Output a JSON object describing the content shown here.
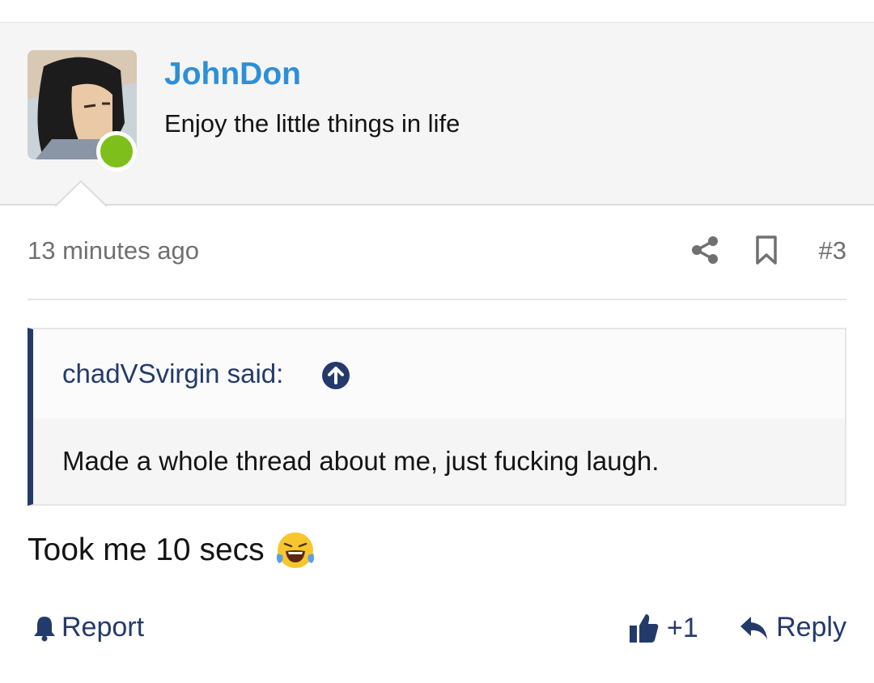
{
  "user": {
    "name": "JohnDon",
    "title": "Enjoy the little things in life",
    "online": true
  },
  "post": {
    "timestamp": "13 minutes ago",
    "number": "#3",
    "body": "Took me 10 secs",
    "body_emoji": "face-with-tears-of-joy"
  },
  "quote": {
    "author_label": "chadVSvirgin said:",
    "text": "Made a whole thread about me, just fucking laugh."
  },
  "actions": {
    "report": "Report",
    "like": "+1",
    "reply": "Reply"
  },
  "icons": {
    "share": "share-icon",
    "bookmark": "bookmark-icon",
    "quote_jump": "arrow-up-circle-icon",
    "report": "bell-icon",
    "like": "thumbs-up-icon",
    "reply": "reply-arrow-icon"
  },
  "colors": {
    "username": "#2d8fd8",
    "accent": "#233a6b",
    "online": "#7fbf1c",
    "muted": "#707070"
  }
}
